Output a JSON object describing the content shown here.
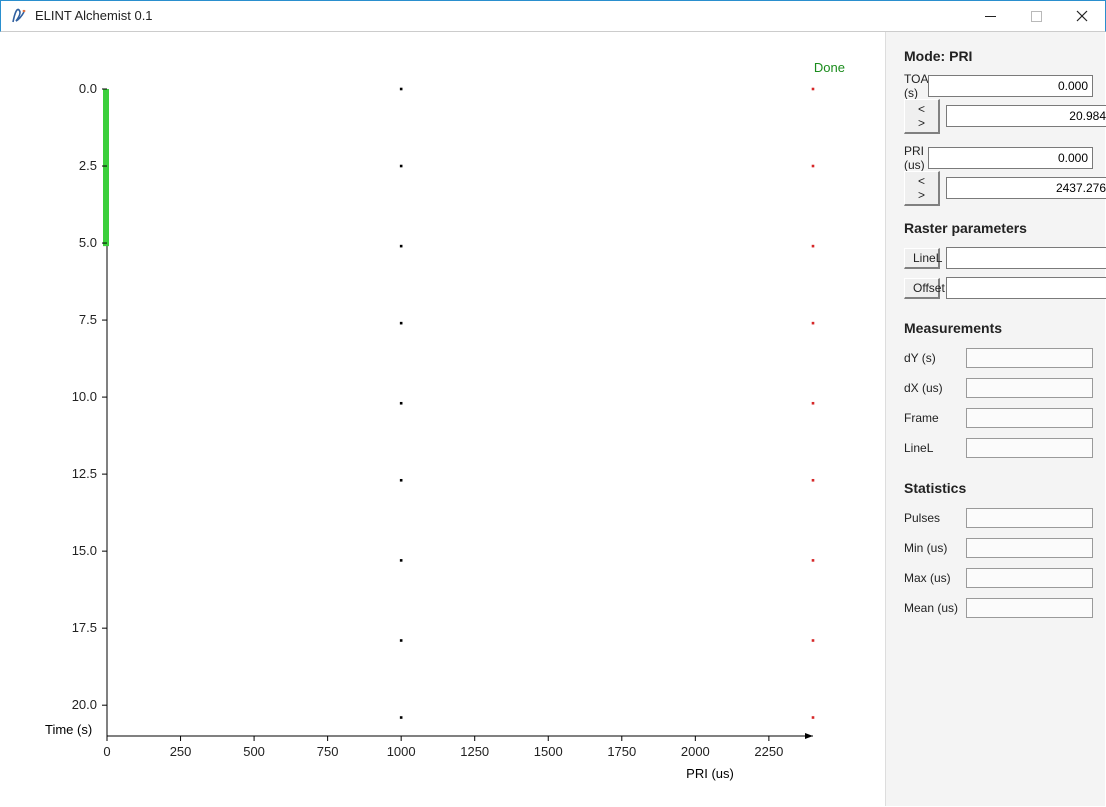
{
  "window": {
    "title": "ELINT Alchemist 0.1"
  },
  "status": {
    "done": "Done"
  },
  "chart_data": {
    "type": "scatter",
    "xlabel": "PRI (us)",
    "ylabel": "Time (s)",
    "xlim": [
      0,
      2400
    ],
    "ylim": [
      0,
      21
    ],
    "xticks": [
      0,
      250,
      500,
      750,
      1000,
      1250,
      1500,
      1750,
      2000,
      2250
    ],
    "yticks": [
      0.0,
      2.5,
      5.0,
      7.5,
      10.0,
      12.5,
      15.0,
      17.5,
      20.0
    ],
    "y_axis_inverted": true,
    "series": [
      {
        "name": "black",
        "color": "#000000",
        "points": [
          {
            "x": 1000,
            "y": 0.0
          },
          {
            "x": 1000,
            "y": 2.5
          },
          {
            "x": 1000,
            "y": 5.1
          },
          {
            "x": 1000,
            "y": 7.6
          },
          {
            "x": 1000,
            "y": 10.2
          },
          {
            "x": 1000,
            "y": 12.7
          },
          {
            "x": 1000,
            "y": 15.3
          },
          {
            "x": 1000,
            "y": 17.9
          },
          {
            "x": 1000,
            "y": 20.4
          }
        ]
      },
      {
        "name": "red",
        "color": "#d62728",
        "points": [
          {
            "x": 2400,
            "y": 0.0
          },
          {
            "x": 2400,
            "y": 2.5
          },
          {
            "x": 2400,
            "y": 5.1
          },
          {
            "x": 2400,
            "y": 7.6
          },
          {
            "x": 2400,
            "y": 10.2
          },
          {
            "x": 2400,
            "y": 12.7
          },
          {
            "x": 2400,
            "y": 15.3
          },
          {
            "x": 2400,
            "y": 17.9
          },
          {
            "x": 2400,
            "y": 20.4
          }
        ]
      }
    ],
    "green_span": {
      "y0": 0.0,
      "y1": 5.1
    }
  },
  "panel": {
    "mode_title": "Mode: PRI",
    "toa": {
      "label": "TOA (s)",
      "start": "0.000",
      "end": "20.984",
      "nav": "< >"
    },
    "pri": {
      "label": "PRI (us)",
      "start": "0.000",
      "end": "2437.276",
      "nav": "< >"
    },
    "raster_title": "Raster parameters",
    "linel_btn": "LineL",
    "offset_btn": "Offset",
    "linel_val": "",
    "offset_val": "",
    "meas_title": "Measurements",
    "meas": {
      "dy": "dY (s)",
      "dx": "dX (us)",
      "frame": "Frame",
      "linel": "LineL"
    },
    "stats_title": "Statistics",
    "stats": {
      "pulses": "Pulses",
      "min": "Min (us)",
      "max": "Max (us)",
      "mean": "Mean (us)"
    }
  }
}
